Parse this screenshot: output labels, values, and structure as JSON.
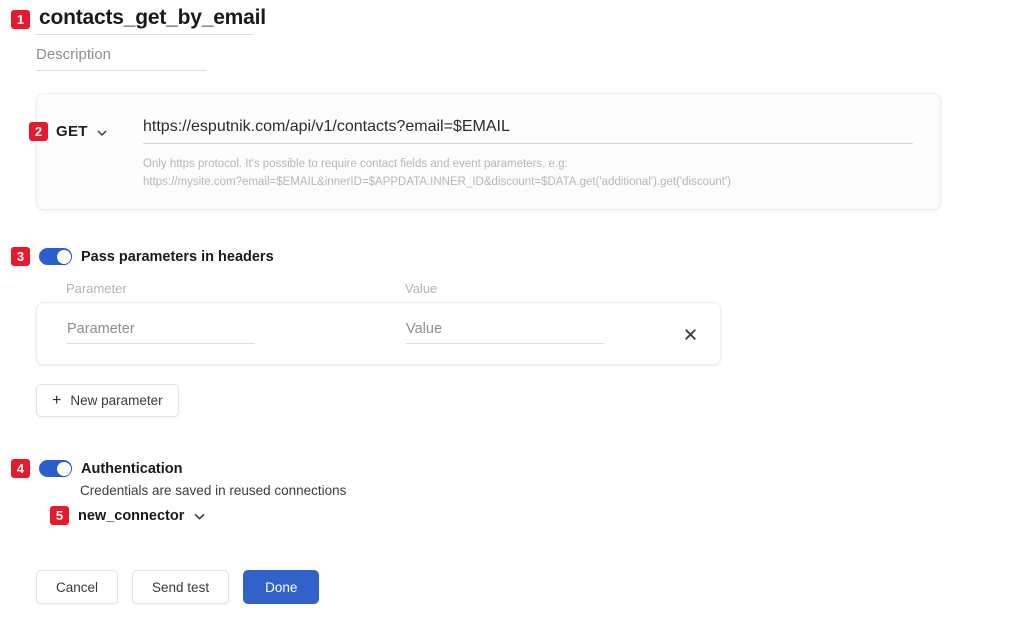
{
  "header": {
    "badge": "1",
    "title": "contacts_get_by_email",
    "description_placeholder": "Description"
  },
  "request": {
    "badge": "2",
    "method": "GET",
    "method_chevron_icon": "chevron-down-icon",
    "url": "https://esputnik.com/api/v1/contacts?email=$EMAIL",
    "hint_line1": "Only https protocol. It's possible to require contact fields and event parameters, e.g:",
    "hint_line2": "https://mysite.com?email=$EMAIL&innerID=$APPDATA.INNER_ID&discount=$DATA.get('additional').get('discount')"
  },
  "headers_section": {
    "badge": "3",
    "toggle_state": "on",
    "title": "Pass parameters in headers",
    "columns": {
      "parameter": "Parameter",
      "value": "Value"
    },
    "rows": [
      {
        "parameter_placeholder": "Parameter",
        "value_placeholder": "Value",
        "remove_icon": "close-icon"
      }
    ],
    "new_parameter_label": "New parameter",
    "new_parameter_icon": "plus-icon"
  },
  "auth_section": {
    "badge": "4",
    "toggle_state": "on",
    "title": "Authentication",
    "subtitle": "Credentials are saved in reused connections",
    "connector": {
      "badge": "5",
      "name": "new_connector",
      "chevron_icon": "chevron-down-icon"
    }
  },
  "footer": {
    "cancel_label": "Cancel",
    "send_test_label": "Send test",
    "done_label": "Done"
  },
  "colors": {
    "badge_red": "#e8192c",
    "toggle_blue": "#2a5fd0",
    "primary_blue": "#3062c8",
    "page_background": "#ffffff"
  }
}
